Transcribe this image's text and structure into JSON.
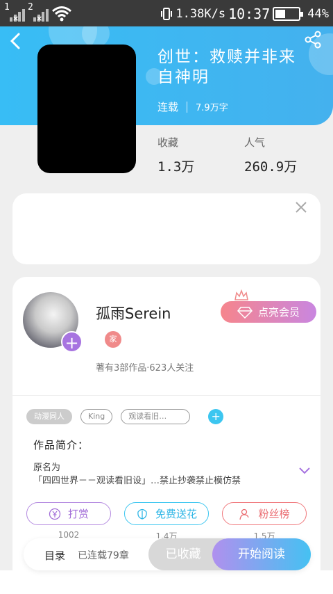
{
  "status_bar": {
    "sim1_number": "1",
    "sim2_number": "2",
    "network_speed": "1.38K/s",
    "time": "10:37",
    "battery_percent": "44%",
    "battery_level": 0.44
  },
  "book": {
    "title_line1": "创世：救赎并非来",
    "title_line2": "自神明",
    "status": "连载",
    "word_count": "7.9万字",
    "favorites_label": "收藏",
    "favorites_value": "1.3万",
    "popularity_label": "人气",
    "popularity_value": "260.9万"
  },
  "author": {
    "name": "孤雨Serein",
    "badge": "家",
    "vip_button": "点亮会员",
    "stats": "著有3部作品·623人关注"
  },
  "tags": [
    "动漫同人",
    "King",
    "观读看旧…"
  ],
  "intro": {
    "title": "作品简介：",
    "line1": "原名为",
    "line2": "「四四世界－－观读看旧设」…禁止抄袭禁止模仿禁"
  },
  "actions": {
    "tip_label": "打赏",
    "tip_count": "1002",
    "flower_label": "免费送花",
    "flower_count": "1.4万",
    "fans_label": "粉丝榜",
    "fans_count": "1.5万"
  },
  "bottom_bar": {
    "toc_label": "目录",
    "toc_status": "已连载79章",
    "collected_label": "已收藏",
    "read_label": "开始阅读"
  },
  "colors": {
    "header_blue": "#3bb8f3",
    "accent_purple": "#a774e0",
    "accent_cyan": "#3cc6f0",
    "accent_red": "#f0787c"
  }
}
